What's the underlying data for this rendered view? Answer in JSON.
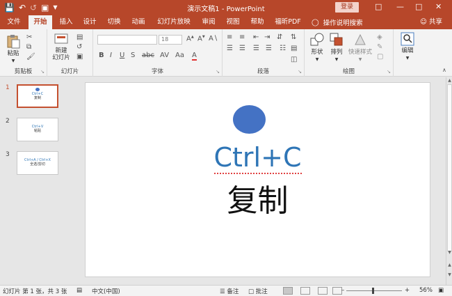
{
  "titlebar": {
    "title": "演示文稿1  -  PowerPoint",
    "login_label": "登录"
  },
  "tabs": [
    {
      "label": "文件"
    },
    {
      "label": "开始"
    },
    {
      "label": "插入"
    },
    {
      "label": "设计"
    },
    {
      "label": "切换"
    },
    {
      "label": "动画"
    },
    {
      "label": "幻灯片放映"
    },
    {
      "label": "审阅"
    },
    {
      "label": "视图"
    },
    {
      "label": "帮助"
    },
    {
      "label": "福昕PDF"
    }
  ],
  "tell_me": "操作说明搜索",
  "share": "共享",
  "ribbon": {
    "clipboard": {
      "paste": "粘贴",
      "label": "剪贴板"
    },
    "slides": {
      "new_slide_line1": "新建",
      "new_slide_line2": "幻灯片",
      "label": "幻灯片"
    },
    "font": {
      "size": "18",
      "label": "字体"
    },
    "paragraph": {
      "label": "段落"
    },
    "drawing": {
      "shapes": "形状",
      "arrange": "排列",
      "quick_styles": "快速样式",
      "label": "绘图"
    },
    "editing": {
      "edit": "编辑"
    }
  },
  "thumbnails": [
    {
      "num": "1",
      "line1": "Ctrl+C",
      "line2": "复制"
    },
    {
      "num": "2",
      "line1": "Ctrl+V",
      "line2": "粘贴"
    },
    {
      "num": "3",
      "line1": "Ctrl+A / Ctrl+X",
      "line2": "全选/剪切"
    }
  ],
  "slide": {
    "title": "Ctrl+C",
    "subtitle": "复制"
  },
  "status": {
    "slide_info": "幻灯片 第 1 张，共 3 张",
    "language": "中文(中国)",
    "notes": "备注",
    "comments": "批注",
    "zoom": "56%"
  },
  "colors": {
    "accent": "#b7472a",
    "shape_fill": "#4472c4",
    "title_text": "#2e75b6"
  }
}
